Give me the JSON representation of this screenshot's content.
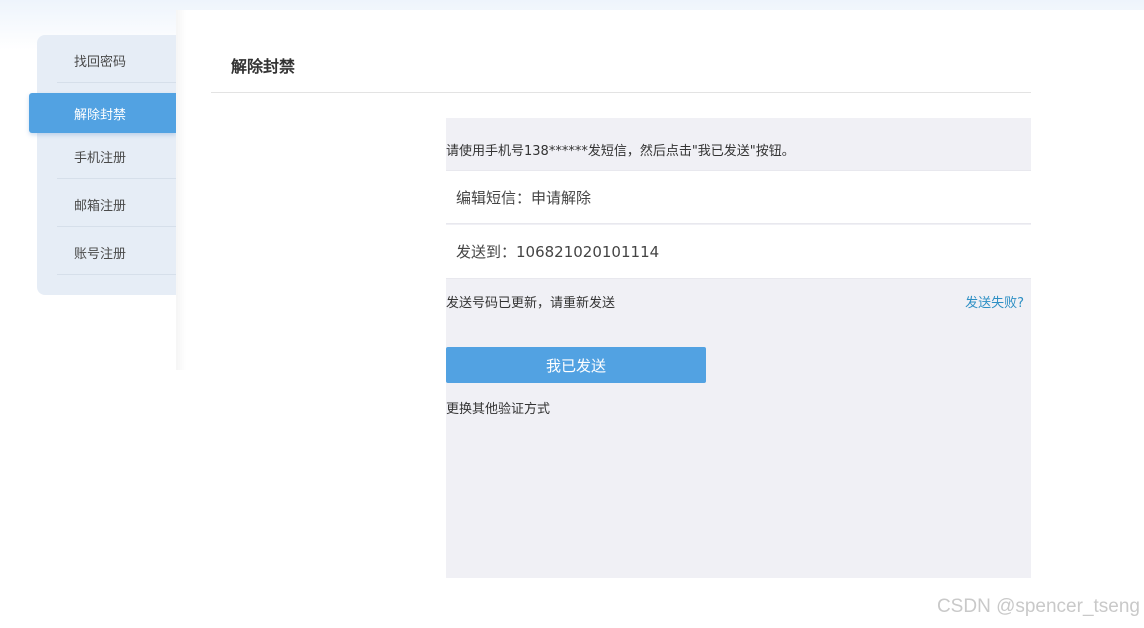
{
  "sidebar": {
    "items": [
      {
        "label": "找回密码",
        "active": false
      },
      {
        "label": "解除封禁",
        "active": true
      },
      {
        "label": "手机注册",
        "active": false
      },
      {
        "label": "邮箱注册",
        "active": false
      },
      {
        "label": "账号注册",
        "active": false
      }
    ]
  },
  "main": {
    "title": "解除封禁",
    "instruction": "请使用手机号138******发短信，然后点击\"我已发送\"按钮。",
    "sms_content_row": "编辑短信：申请解除",
    "send_to_row": "发送到：106821020101114",
    "updated_message": "发送号码已更新，请重新发送",
    "send_failed_link": "发送失败?",
    "sent_button": "我已发送",
    "other_method_link": "更换其他验证方式"
  },
  "watermark": "CSDN @spencer_tseng",
  "colors": {
    "accent": "#52a2e2",
    "link": "#2d8fc4",
    "sidebar_bg": "#e6edf6",
    "panel_bg": "#f0f0f5"
  }
}
